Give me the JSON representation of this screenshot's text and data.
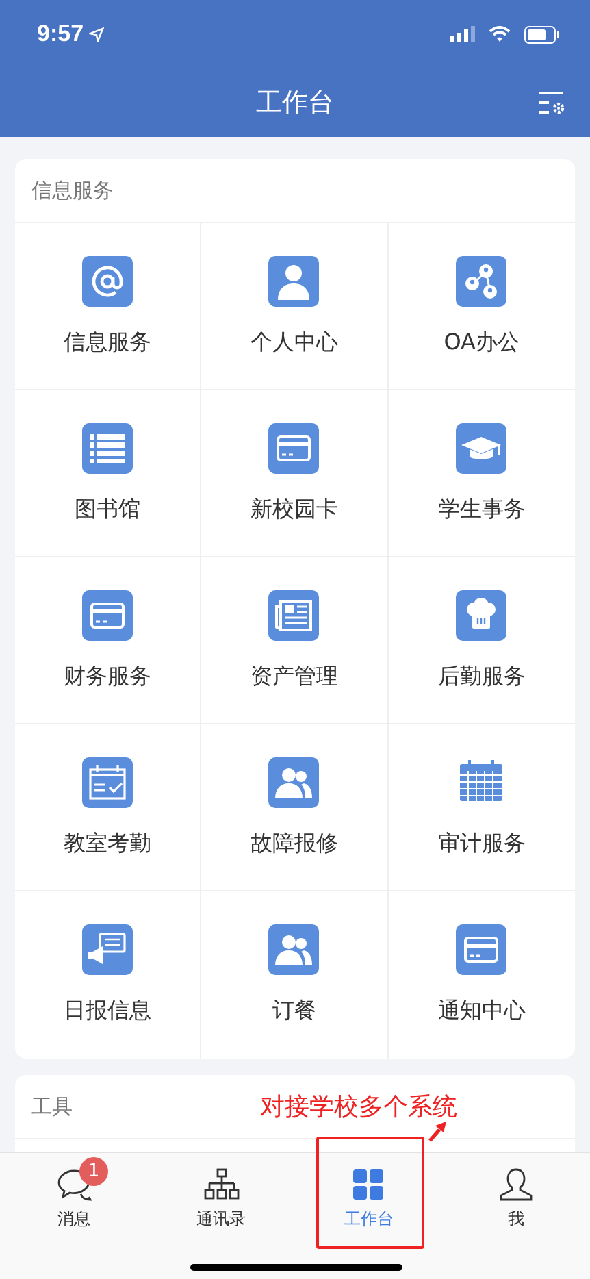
{
  "status_bar": {
    "time": "9:57"
  },
  "header": {
    "title": "工作台"
  },
  "sections": [
    {
      "title": "信息服务",
      "items": [
        {
          "label": "信息服务"
        },
        {
          "label": "个人中心"
        },
        {
          "label": "OA办公"
        },
        {
          "label": "图书馆"
        },
        {
          "label": "新校园卡"
        },
        {
          "label": "学生事务"
        },
        {
          "label": "财务服务"
        },
        {
          "label": "资产管理"
        },
        {
          "label": "后勤服务"
        },
        {
          "label": "教室考勤"
        },
        {
          "label": "故障报修"
        },
        {
          "label": "审计服务"
        },
        {
          "label": "日报信息"
        },
        {
          "label": "订餐"
        },
        {
          "label": "通知中心"
        }
      ]
    },
    {
      "title": "工具"
    }
  ],
  "annotation": {
    "text": "对接学校多个系统"
  },
  "tab_bar": [
    {
      "label": "消息",
      "selected": false,
      "badge": "1"
    },
    {
      "label": "通讯录",
      "selected": false
    },
    {
      "label": "工作台",
      "selected": true
    },
    {
      "label": "我",
      "selected": false
    }
  ]
}
